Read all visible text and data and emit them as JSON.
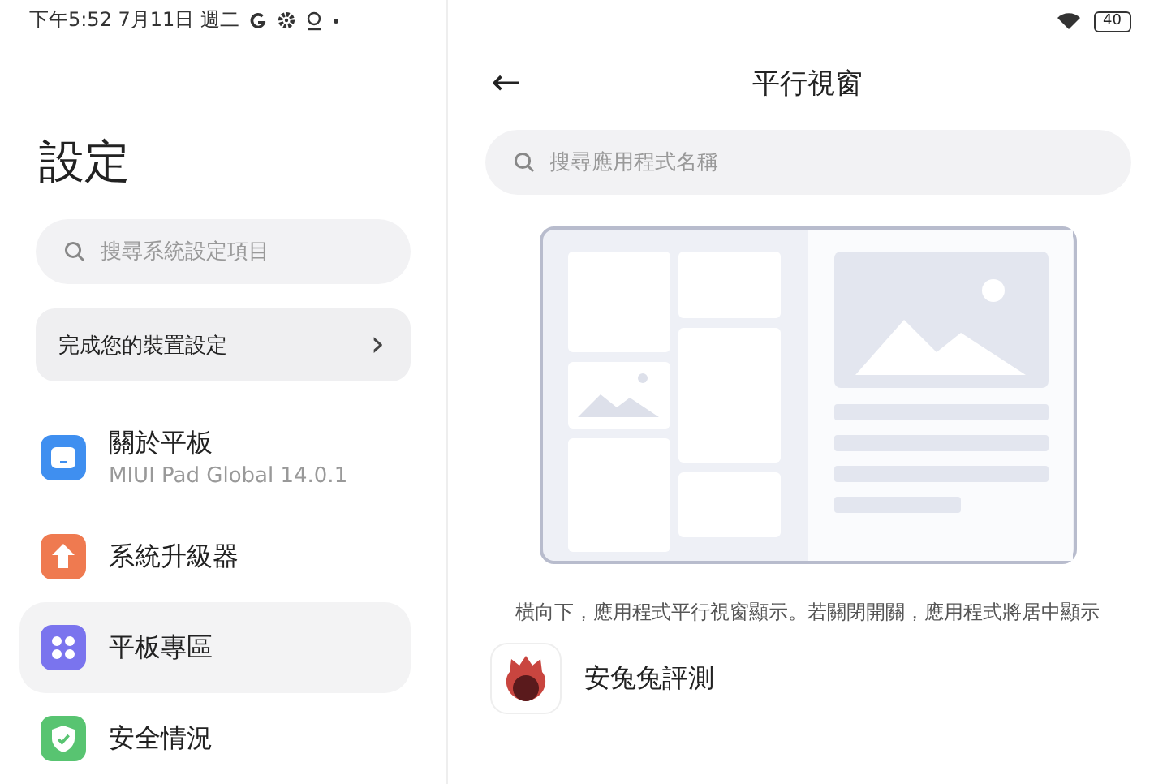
{
  "status_bar": {
    "clock": "下午5:52 7月11日 週二",
    "battery": "40"
  },
  "sidebar": {
    "title": "設定",
    "search": {
      "placeholder": "搜尋系統設定項目"
    },
    "setup_card": {
      "label": "完成您的裝置設定",
      "chevron": "›"
    },
    "items": [
      {
        "kind": "tablet",
        "color": "#3f8ff0",
        "label": "關於平板",
        "subtitle": "MIUI Pad Global 14.0.1",
        "selected": false
      },
      {
        "kind": "upgrade",
        "color": "#ef7a50",
        "label": "系統升級器",
        "selected": false
      },
      {
        "kind": "grid",
        "color": "#7a74ee",
        "label": "平板專區",
        "selected": true
      },
      {
        "kind": "shield",
        "color": "#58c471",
        "label": "安全情況",
        "selected": false
      }
    ]
  },
  "detail": {
    "back": "←",
    "title": "平行視窗",
    "search": {
      "placeholder": "搜尋應用程式名稱"
    },
    "caption": "橫向下，應用程式平行視窗顯示。若關閉開關，應用程式將居中顯示",
    "apps": [
      {
        "name": "安兔兔評測"
      }
    ]
  }
}
